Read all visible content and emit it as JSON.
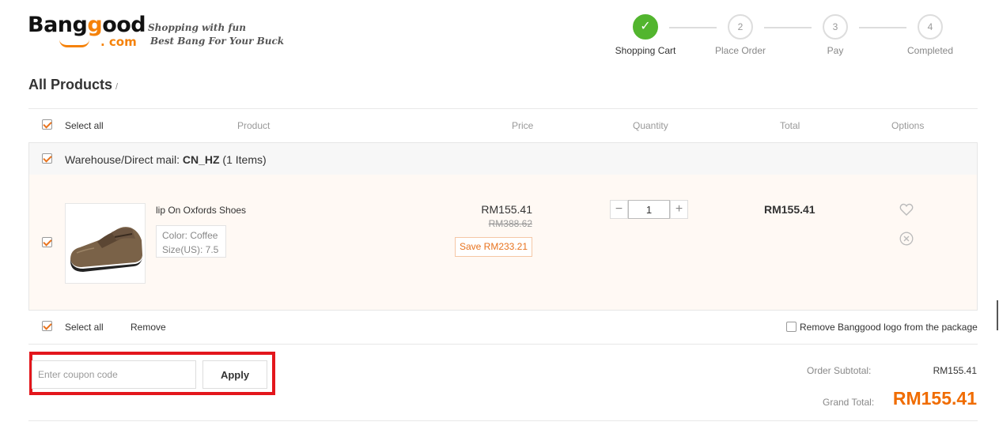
{
  "brand": {
    "logo_main_1": "Bang",
    "logo_main_2": "g",
    "logo_main_3": "ood",
    "logo_com": ". com",
    "tagline_1": "Shopping with fun",
    "tagline_2": "Best Bang For Your Buck",
    "colors": {
      "accent": "#f5820a",
      "step_done": "#52b52e",
      "highlight": "#e3161c",
      "price": "#f06c00"
    }
  },
  "steps": [
    {
      "number": "✓",
      "label": "Shopping Cart",
      "state": "done"
    },
    {
      "number": "2",
      "label": "Place Order",
      "state": "pending"
    },
    {
      "number": "3",
      "label": "Pay",
      "state": "pending"
    },
    {
      "number": "4",
      "label": "Completed",
      "state": "pending"
    }
  ],
  "page": {
    "title": "All Products",
    "title_suffix": "/"
  },
  "table": {
    "select_all": "Select all",
    "headers": {
      "product": "Product",
      "price": "Price",
      "quantity": "Quantity",
      "total": "Total",
      "options": "Options"
    }
  },
  "warehouse": {
    "prefix": "Warehouse/Direct mail: ",
    "code": "CN_HZ",
    "count": " (1 Items)"
  },
  "item": {
    "name": "lip On Oxfords Shoes",
    "color": "Color: Coffee",
    "size": "Size(US): 7.5",
    "price": "RM155.41",
    "original_price": "RM388.62",
    "save": "Save RM233.21",
    "quantity": "1",
    "qty_minus": "−",
    "qty_plus": "+",
    "total": "RM155.41",
    "icons": [
      "heart-icon",
      "remove-icon"
    ]
  },
  "footer_bar": {
    "select_all": "Select all",
    "remove": "Remove",
    "remove_logo": "Remove Banggood logo from the package"
  },
  "coupon": {
    "placeholder": "Enter coupon code",
    "apply": "Apply"
  },
  "summary": {
    "subtotal_label": "Order Subtotal:",
    "subtotal_value": "RM155.41",
    "grand_label": "Grand Total:",
    "grand_value": "RM155.41"
  }
}
